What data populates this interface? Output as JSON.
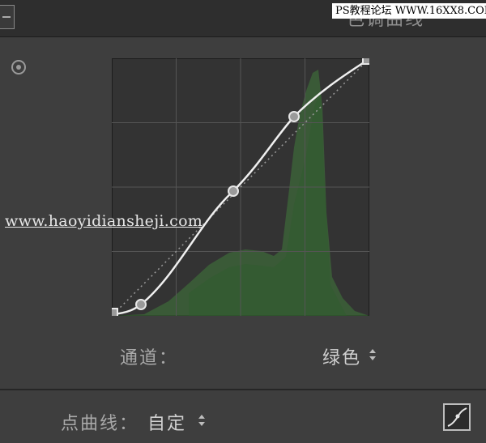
{
  "panel": {
    "title": "色调曲线",
    "watermark_top": "PS教程论坛 WWW.16XX8.COM",
    "watermark_mid": "www.haoyidiansheji.com"
  },
  "channel": {
    "label": "通道：",
    "value": "绿色"
  },
  "point_curve": {
    "label": "点曲线：",
    "value": "自定"
  },
  "curve": {
    "channel_color": "#3f7a3a",
    "points": [
      [
        0,
        0
      ],
      [
        0.11,
        0.04
      ],
      [
        0.47,
        0.49
      ],
      [
        0.7,
        0.77
      ],
      [
        1,
        1
      ]
    ]
  },
  "icons": {
    "collapse": "collapse-toggle-icon",
    "target": "target-adjust-icon",
    "dropdown": "up-down-arrow-icon",
    "curve_edit": "curve-edit-icon"
  }
}
